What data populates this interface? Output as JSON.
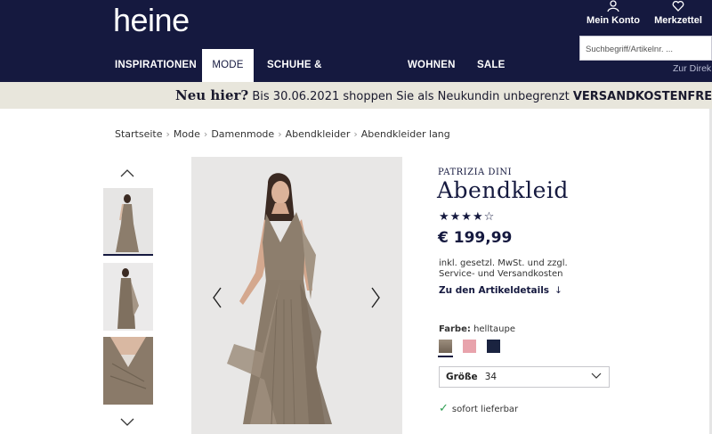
{
  "header": {
    "logo": "heine",
    "account_label": "Mein Konto",
    "wishlist_label": "Merkzettel",
    "search_placeholder": "Suchbegriff/Artikelnr. ...",
    "nav": [
      "INSPIRATIONEN",
      "MODE",
      "SCHUHE & ACCESSOIRES",
      "WOHNEN",
      "SALE"
    ],
    "nav_active": "MODE",
    "zur_link": "Zur Direk"
  },
  "promo": {
    "headline": "Neu hier?",
    "text": " Bis 30.06.2021 shoppen Sie als Neukundin unbegrenzt ",
    "strong": "VERSANDKOSTENFREI*"
  },
  "breadcrumb": [
    "Startseite",
    "Mode",
    "Damenmode",
    "Abendkleider",
    "Abendkleider lang"
  ],
  "product": {
    "brand": "PATRIZIA DINI",
    "title": "Abendkleid",
    "rating_stars": "★★★★☆",
    "rating": 4,
    "price": "€ 199,99",
    "tax_line1": "inkl. gesetzl. MwSt. und zzgl.",
    "tax_line2": "Service- und Versandkosten",
    "details_link": "Zu den Artikeldetails",
    "color_label": "Farbe:",
    "color_value": "helltaupe",
    "swatch_colors": [
      "#8a7b6b",
      "#e8a3ac",
      "#1a2340"
    ],
    "size_label": "Größe",
    "size_value": "34",
    "availability": "sofort lieferbar"
  },
  "colors": {
    "header_bg": "#15193f",
    "promo_bg": "#e8e6dc",
    "dress": "#8a7b6b",
    "check_green": "#2e9e52"
  }
}
